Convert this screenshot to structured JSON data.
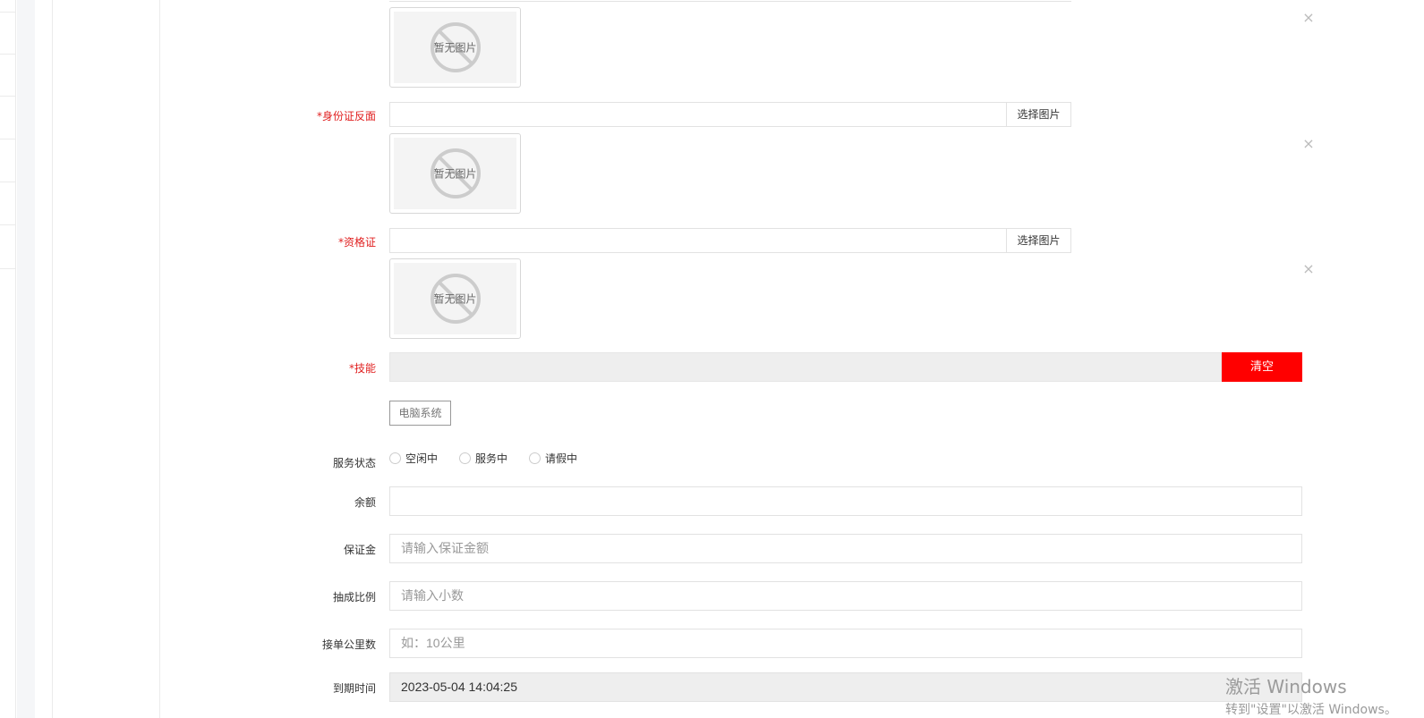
{
  "fields": {
    "id_back": {
      "label": "*身份证反面",
      "button": "选择图片"
    },
    "qualification": {
      "label": "*资格证",
      "button": "选择图片"
    },
    "no_image_text": "暂无图片",
    "close_symbol": "×",
    "skills": {
      "label": "*技能",
      "clear_button": "清空",
      "tags": [
        "电脑系统"
      ]
    },
    "service_status": {
      "label": "服务状态",
      "options": [
        "空闲中",
        "服务中",
        "请假中"
      ]
    },
    "balance": {
      "label": "余额",
      "value": ""
    },
    "deposit": {
      "label": "保证金",
      "placeholder": "请输入保证金额"
    },
    "commission": {
      "label": "抽成比例",
      "placeholder": "请输入小数"
    },
    "distance": {
      "label": "接单公里数",
      "placeholder": "如：10公里"
    },
    "expiry": {
      "label": "到期时间",
      "value": "2023-05-04 14:04:25"
    }
  },
  "watermark": {
    "line1": "激活 Windows",
    "line2": "转到\"设置\"以激活 Windows。"
  },
  "colors": {
    "required": "#e02020",
    "clear_button": "#ff0000"
  },
  "icons": {
    "placeholder": "no-image-icon",
    "close": "close-icon"
  }
}
